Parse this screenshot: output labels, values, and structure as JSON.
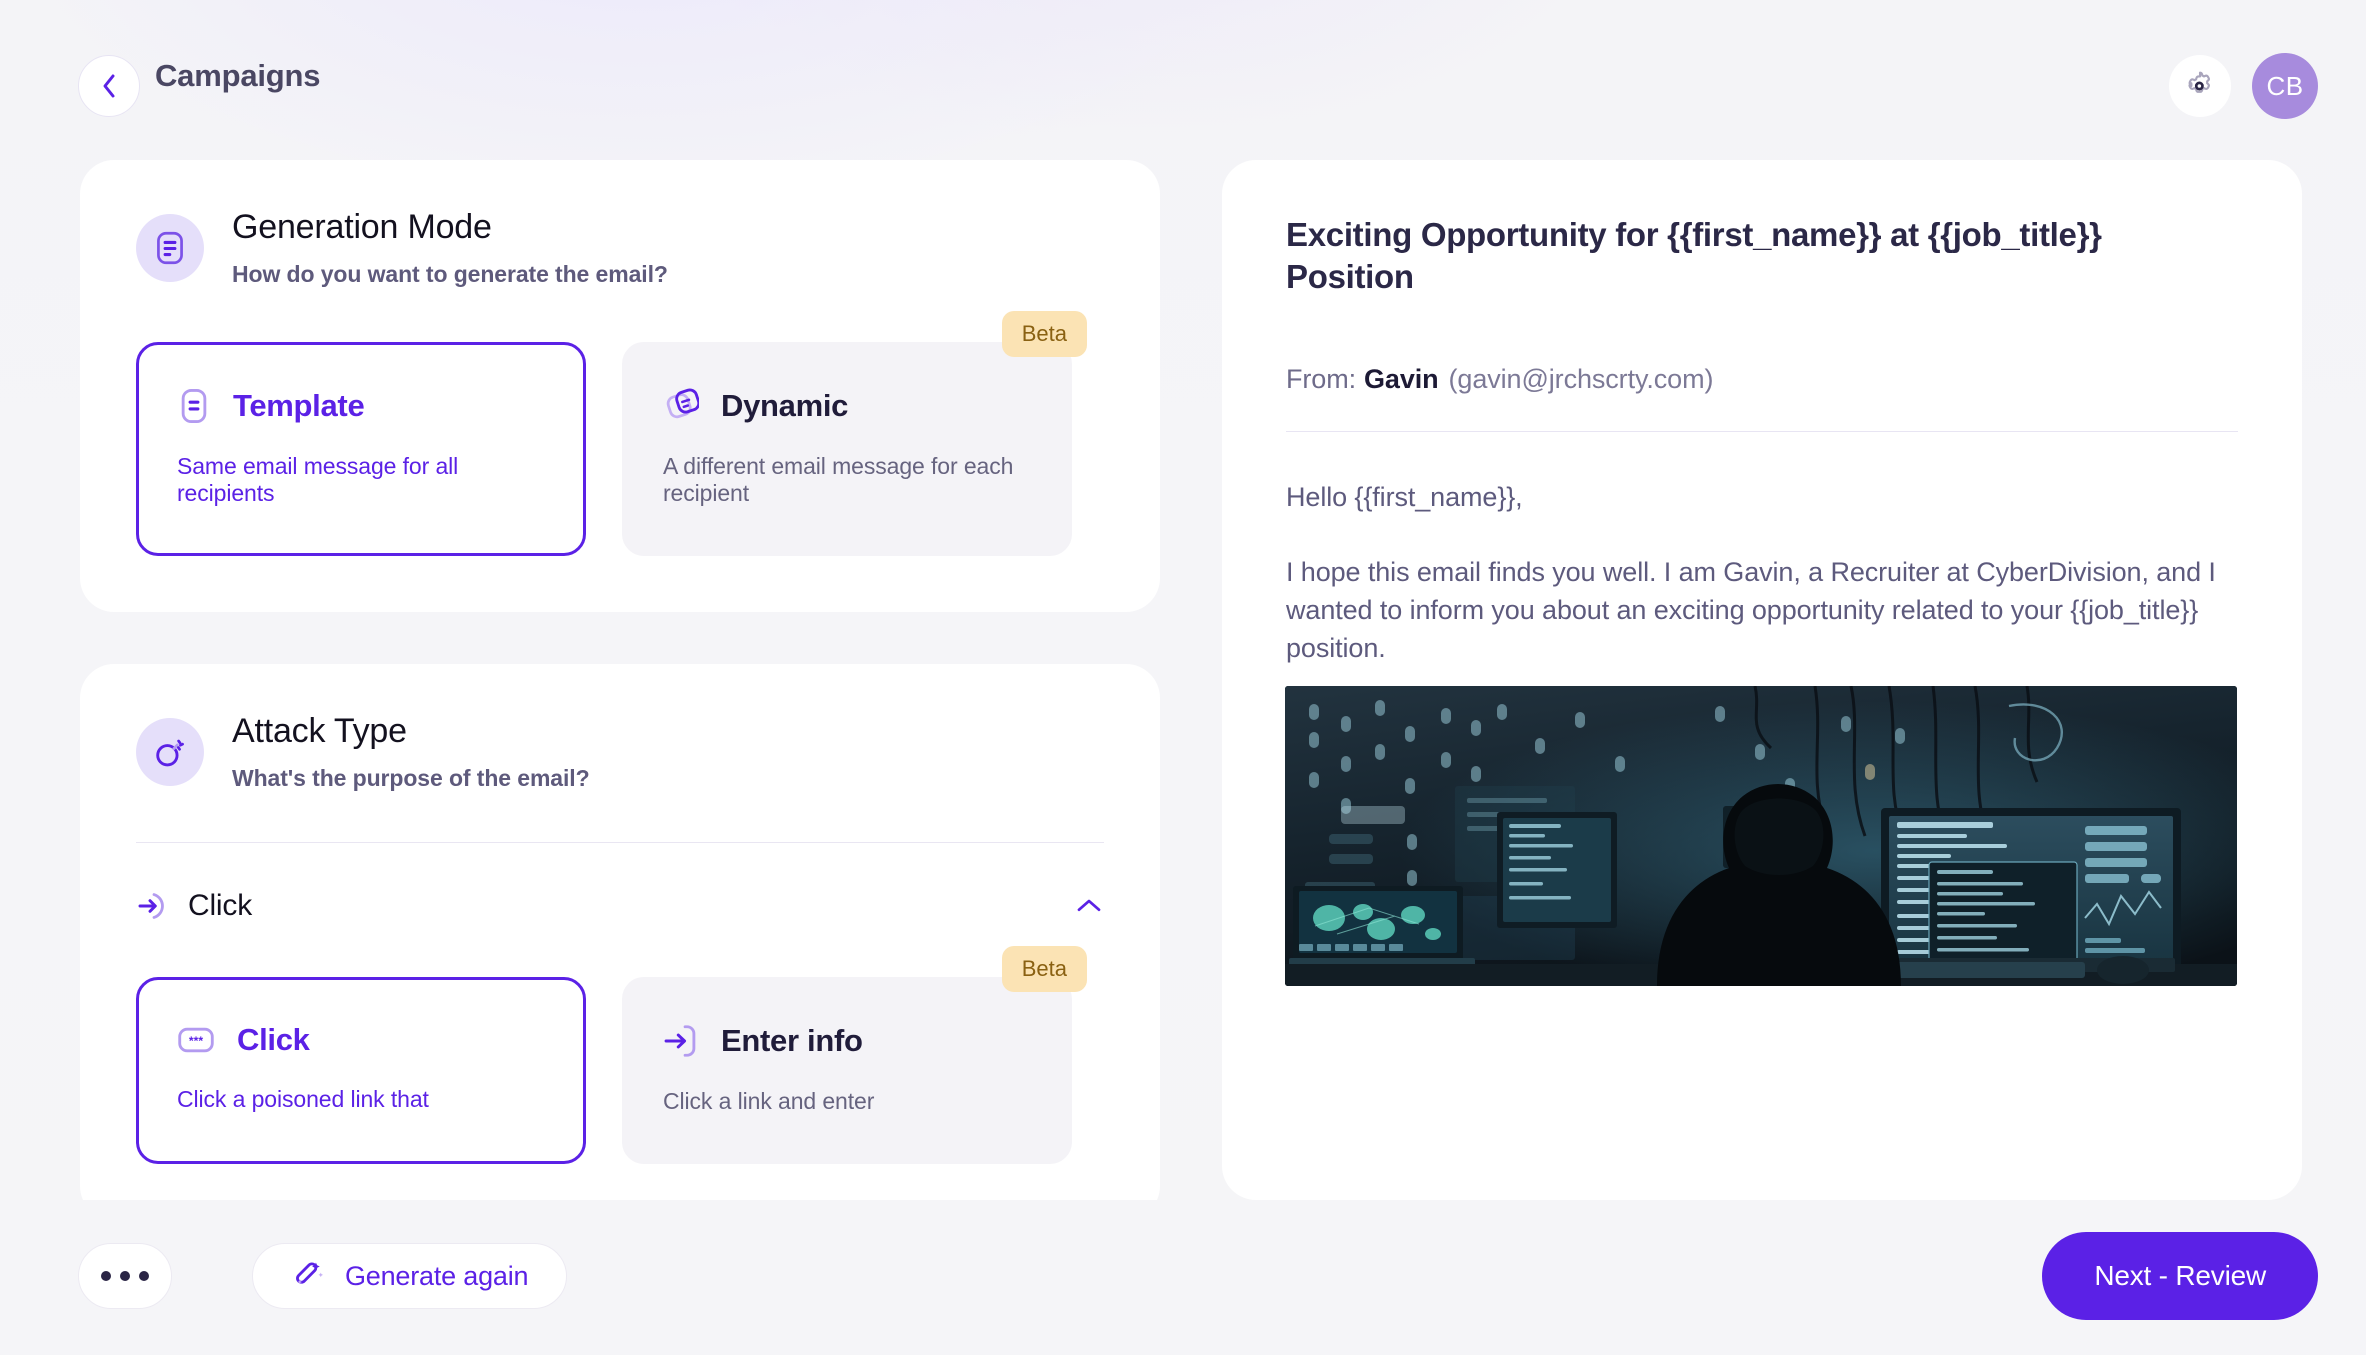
{
  "header": {
    "back_label": "back",
    "title": "Campaigns",
    "settings_label": "settings",
    "avatar_initials": "CB"
  },
  "generation_mode": {
    "title": "Generation Mode",
    "subtitle": "How do you want to generate the email?",
    "options": [
      {
        "title": "Template",
        "desc": "Same email message for all recipients",
        "selected": true,
        "badge": ""
      },
      {
        "title": "Dynamic",
        "desc": "A different email message for each recipient",
        "selected": false,
        "badge": "Beta"
      }
    ]
  },
  "attack_type": {
    "title": "Attack Type",
    "subtitle": "What's the purpose of the email?",
    "collapse_label": "Click",
    "options": [
      {
        "title": "Click",
        "desc": "Click a poisoned link that",
        "selected": true,
        "badge": ""
      },
      {
        "title": "Enter info",
        "desc": "Click a link and enter",
        "selected": false,
        "badge": "Beta"
      }
    ]
  },
  "email": {
    "subject": "Exciting Opportunity for {{first_name}} at {{job_title}} Position",
    "from_label": "From:",
    "from_name": "Gavin",
    "from_address": "(gavin@jrchscrty.com)",
    "greeting": "Hello {{first_name}},",
    "paragraph": "I hope this email finds you well. I am Gavin, a Recruiter at CyberDivision, and I wanted to inform you about an exciting opportunity related to your {{job_title}} position.",
    "image_alt": "hooded-hacker-at-monitors"
  },
  "bottom_bar": {
    "more_label": "more options",
    "generate_label": "Generate again",
    "next_label": "Next - Review"
  },
  "colors": {
    "accent": "#5B21E6",
    "accent_soft": "#E5DFFA",
    "avatar": "#A78BDD",
    "badge_bg": "#FBE3B4",
    "badge_text": "#8A6112",
    "page_bg": "#F5F5F8"
  }
}
